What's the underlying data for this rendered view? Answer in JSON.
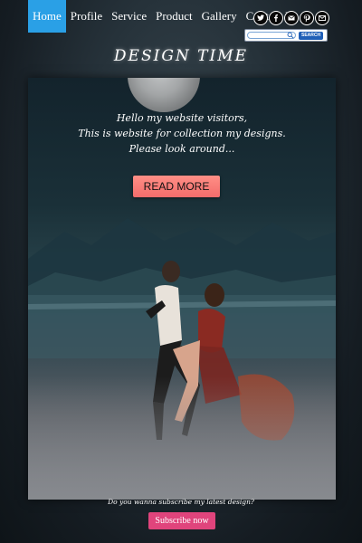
{
  "nav": {
    "items": [
      {
        "label": "Home",
        "active": true
      },
      {
        "label": "Profile",
        "active": false
      },
      {
        "label": "Service",
        "active": false
      },
      {
        "label": "Product",
        "active": false
      },
      {
        "label": "Gallery",
        "active": false
      },
      {
        "label": "Contact Us",
        "active": false
      }
    ]
  },
  "social": {
    "icons": [
      "twitter-icon",
      "facebook-icon",
      "mail-icon",
      "pinterest-icon",
      "message-icon"
    ]
  },
  "search": {
    "placeholder": "",
    "value": "",
    "button_label": "SEARCH"
  },
  "brand": {
    "title": "DESIGN TIME"
  },
  "hero": {
    "lines": [
      "Hello my website visitors,",
      "This is website for collection my designs.",
      "Please look around..."
    ],
    "button_label": "READ MORE"
  },
  "footer": {
    "prompt": "Do you wanna subscribe my latest design?",
    "button_label": "Subscribe now"
  },
  "colors": {
    "nav_active": "#2aa0e6",
    "read_more": "#f36c6b",
    "subscribe": "#e0447c",
    "search_button": "#1f5fb7"
  }
}
